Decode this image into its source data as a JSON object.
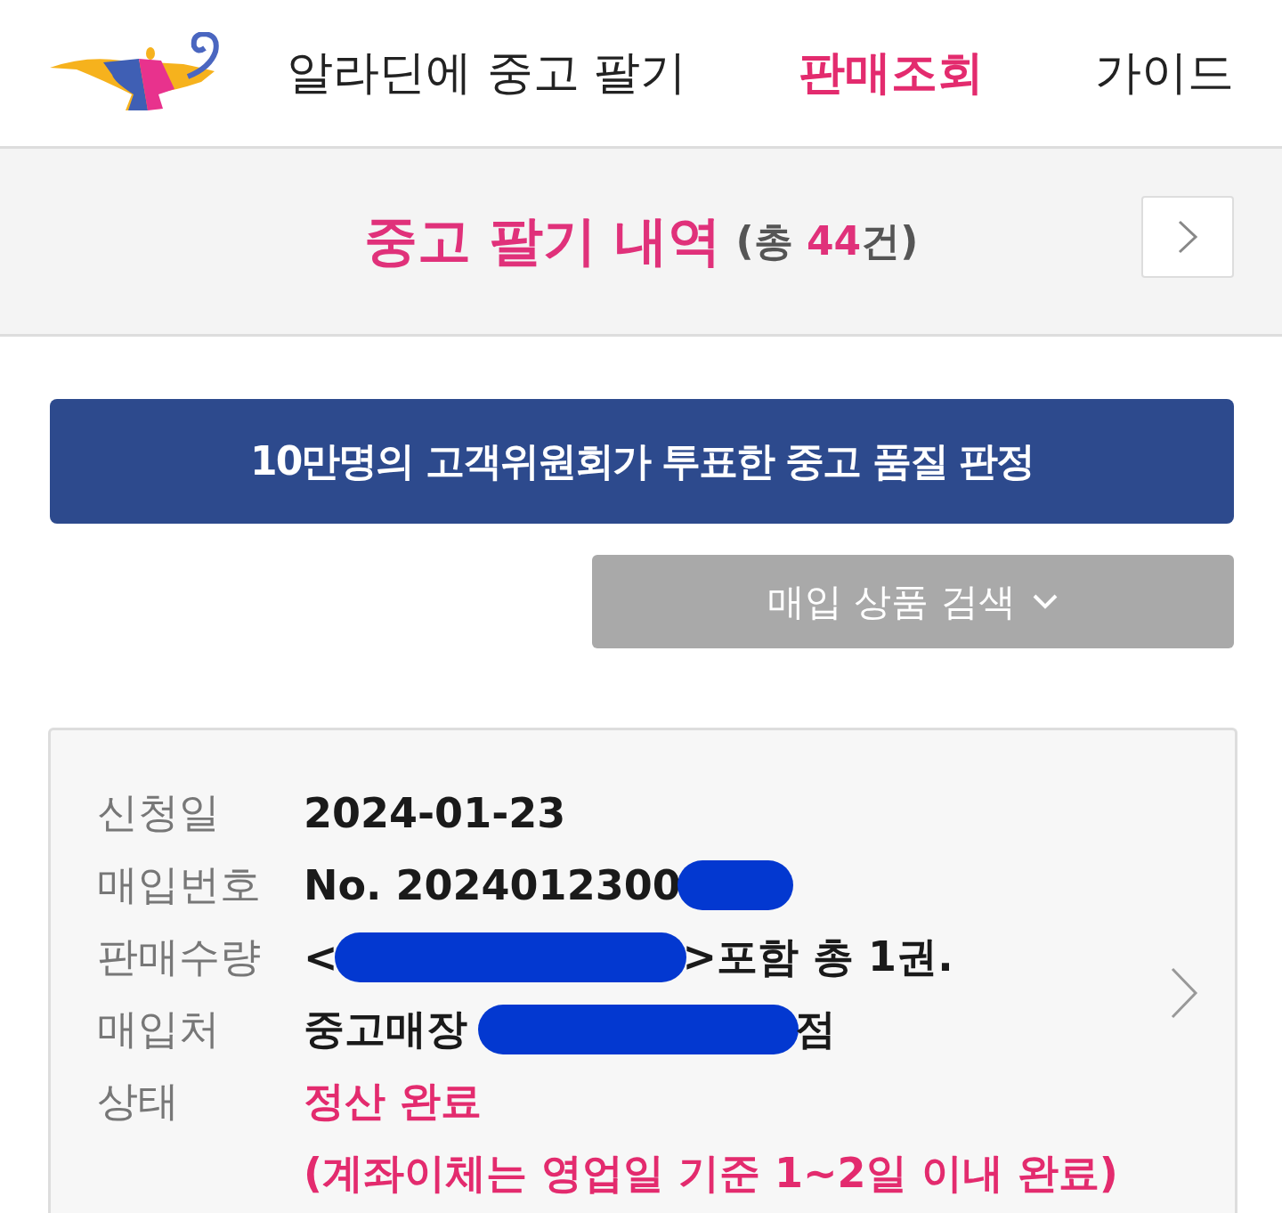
{
  "nav": [
    {
      "label": "알라딘에 중고 팔기",
      "selected": false
    },
    {
      "label": "판매조회",
      "selected": true
    },
    {
      "label": "가이드",
      "selected": false
    }
  ],
  "summary": {
    "title": "중고 팔기 내역",
    "count_prefix": "(총",
    "count": "44",
    "count_suffix": "건)"
  },
  "banner": "10만명의 고객위원회가 투표한 중고 품질 판정",
  "search_button": "매입 상품 검색",
  "record": {
    "rows": [
      {
        "label": "신청일",
        "kind": "plain",
        "parts": [
          {
            "kind": "text",
            "text": "2024-01-23"
          }
        ]
      },
      {
        "label": "매입번호",
        "kind": "plain",
        "parts": [
          {
            "kind": "text",
            "text": "No. 2024012300"
          },
          {
            "kind": "redaction"
          }
        ]
      },
      {
        "label": "판매수량",
        "kind": "plain",
        "parts": [
          {
            "kind": "text",
            "text": "<"
          },
          {
            "kind": "redaction"
          },
          {
            "kind": "text",
            "text": ">포함 총 1권."
          }
        ]
      },
      {
        "label": "매입처",
        "kind": "plain",
        "parts": [
          {
            "kind": "text",
            "text": "중고매장 "
          },
          {
            "kind": "redaction"
          },
          {
            "kind": "text",
            "text": "점"
          }
        ]
      },
      {
        "label": "상태",
        "kind": "status",
        "parts": [
          {
            "kind": "text",
            "text": "정산 완료"
          },
          {
            "kind": "text",
            "text": "(계좌이체는 영업일 기준 1~2일 이내 완료)"
          }
        ]
      }
    ]
  }
}
